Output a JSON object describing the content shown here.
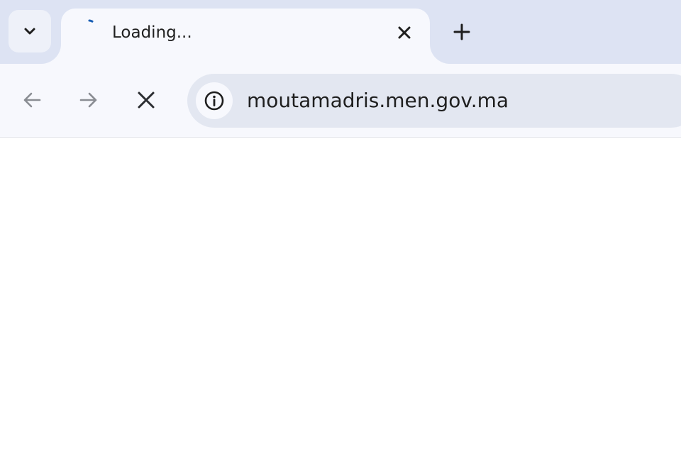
{
  "tabstrip": {
    "tab_search_icon": "chevron-down-icon",
    "active_tab": {
      "title": "Loading...",
      "favicon_icon": "loading-spinner-icon",
      "close_icon": "close-icon"
    },
    "new_tab_icon": "plus-icon"
  },
  "toolbar": {
    "back_icon": "arrow-left-icon",
    "forward_icon": "arrow-right-icon",
    "stop_icon": "close-icon",
    "omnibox": {
      "site_info_icon": "info-icon",
      "url": "moutamadris.men.gov.ma"
    }
  },
  "colors": {
    "tabstrip_bg": "#dde3f3",
    "toolbar_bg": "#f7f8fd",
    "omnibox_bg": "#e3e7f1",
    "spinner": "#1a5fb4",
    "icon_dark": "#1f1f1f",
    "icon_disabled": "#8a8d93"
  }
}
